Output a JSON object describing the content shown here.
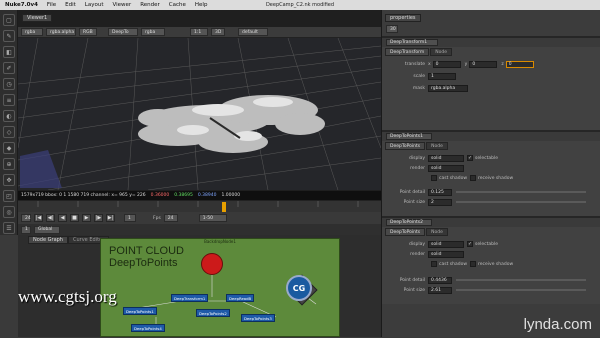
{
  "menu": {
    "app": "Nuke7.0v4",
    "items": [
      "File",
      "Edit",
      "Layout",
      "Viewer",
      "Render",
      "Cache",
      "Help"
    ]
  },
  "window_title": "DeepCamp_C2.nk modified",
  "viewer": {
    "tab": "Viewer1",
    "toolbar": [
      "rgba",
      "rgba.alpha",
      "RGB",
      "DeepTo",
      "rgba",
      "3D",
      "default"
    ],
    "zoom": "1:1",
    "info": {
      "res": "1579x719 bbox: 0 1 1580 719 channel: x= 965 y= 226",
      "r": "0.36000",
      "g": "0.38695",
      "b": "0.38940",
      "a": "1.00000"
    },
    "fps": "24",
    "frame_in": "1",
    "frame_out": "1-50",
    "frame_label": "Fps",
    "cbox": "1",
    "global": "Global"
  },
  "node_graph": {
    "tabs": [
      "Node Graph",
      "Curve Editor"
    ]
  },
  "backdrop": {
    "line1": "POINT CLOUD",
    "line2": "DeepToPoints",
    "label": "BackdropNode1"
  },
  "nodes": [
    "DeepTransform1",
    "DeepReadB",
    "DeepToPoints1",
    "DeepToPoints2",
    "DeepToPoints3",
    "DeepToPoints4"
  ],
  "watermark": {
    "left": "www.cgtsj.org",
    "right": "lynda.com",
    "logo": "CG"
  },
  "properties": {
    "title": "properties",
    "max": "30",
    "sections": [
      {
        "name": "DeepTransform1",
        "tabs": [
          "DeepTransform",
          "Node"
        ],
        "rows": [
          {
            "label": "translate",
            "x": "x",
            "xv": "0",
            "y": "y",
            "yv": "0",
            "z": "z",
            "zv": "0"
          },
          {
            "label": "scale",
            "value": "1"
          },
          {
            "label": "mask",
            "value": "rgba.alpha"
          }
        ]
      },
      {
        "name": "DeepToPoints1",
        "tabs": [
          "DeepToPoints",
          "Node"
        ],
        "rows": [
          {
            "label": "display",
            "value": "solid",
            "check": "selectable"
          },
          {
            "label": "render",
            "value": "solid"
          },
          {
            "label": "",
            "check1": "cast shadow",
            "check2": "receive shadow"
          },
          {
            "label": "Point detail",
            "value": "0.125"
          },
          {
            "label": "Point size",
            "value": "2"
          }
        ]
      },
      {
        "name": "DeepToPoints2",
        "tabs": [
          "DeepToPoints",
          "Node"
        ],
        "rows": [
          {
            "label": "display",
            "value": "solid",
            "check": "selectable"
          },
          {
            "label": "render",
            "value": "solid"
          },
          {
            "label": "",
            "check1": "cast shadow",
            "check2": "receive shadow"
          },
          {
            "label": "Point detail",
            "value": "0.4436"
          },
          {
            "label": "Point size",
            "value": "2.61"
          }
        ]
      }
    ]
  },
  "icons": [
    "viewer-tool-icon",
    "cg-logo-icon"
  ]
}
